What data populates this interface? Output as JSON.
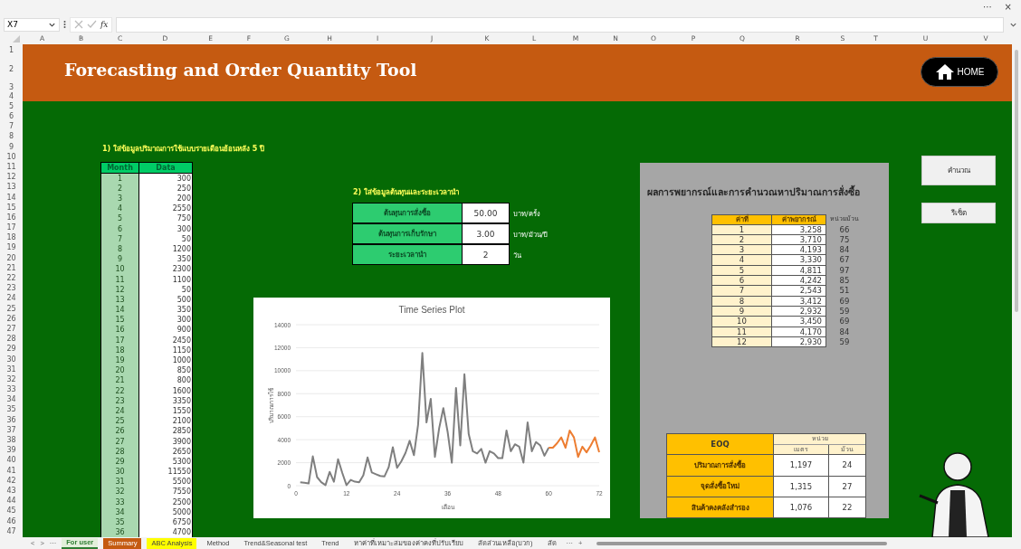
{
  "window": {
    "more": "···",
    "close": "×"
  },
  "formula_bar": {
    "name_box": "X7",
    "function_label": "fx"
  },
  "columns": [
    "A",
    "B",
    "C",
    "D",
    "E",
    "F",
    "G",
    "H",
    "I",
    "J",
    "K",
    "L",
    "M",
    "N",
    "O",
    "P",
    "Q",
    "R",
    "S",
    "T",
    "U",
    "V"
  ],
  "rows": [
    "1",
    "2",
    "3",
    "4",
    "5",
    "6",
    "7",
    "8",
    "9",
    "10",
    "11",
    "12",
    "13",
    "14",
    "15",
    "16",
    "17",
    "18",
    "19",
    "20",
    "21",
    "22",
    "23",
    "24",
    "25",
    "26",
    "27",
    "28",
    "29",
    "30",
    "31",
    "32",
    "33",
    "34",
    "35",
    "36",
    "37",
    "38",
    "39",
    "40",
    "41",
    "42",
    "43",
    "44",
    "45",
    "46",
    "47"
  ],
  "banner": {
    "title": "Forecasting and Order Quantity Tool",
    "home_button": "HOME"
  },
  "usage": {
    "heading": "1) ใส่ข้อมูลปริมาณการใช้แบบรายเดือนย้อนหลัง 5 ปี",
    "columns": [
      "Month",
      "Data"
    ],
    "rows": [
      [
        "1",
        "300"
      ],
      [
        "2",
        "250"
      ],
      [
        "3",
        "200"
      ],
      [
        "4",
        "2550"
      ],
      [
        "5",
        "750"
      ],
      [
        "6",
        "300"
      ],
      [
        "7",
        "50"
      ],
      [
        "8",
        "1200"
      ],
      [
        "9",
        "350"
      ],
      [
        "10",
        "2300"
      ],
      [
        "11",
        "1100"
      ],
      [
        "12",
        "50"
      ],
      [
        "13",
        "500"
      ],
      [
        "14",
        "350"
      ],
      [
        "15",
        "300"
      ],
      [
        "16",
        "900"
      ],
      [
        "17",
        "2450"
      ],
      [
        "18",
        "1150"
      ],
      [
        "19",
        "1000"
      ],
      [
        "20",
        "850"
      ],
      [
        "21",
        "800"
      ],
      [
        "22",
        "1600"
      ],
      [
        "23",
        "3350"
      ],
      [
        "24",
        "1550"
      ],
      [
        "25",
        "2100"
      ],
      [
        "26",
        "2850"
      ],
      [
        "27",
        "3900"
      ],
      [
        "28",
        "2650"
      ],
      [
        "29",
        "5300"
      ],
      [
        "30",
        "11550"
      ],
      [
        "31",
        "5500"
      ],
      [
        "32",
        "7550"
      ],
      [
        "33",
        "2500"
      ],
      [
        "34",
        "5000"
      ],
      [
        "35",
        "6750"
      ],
      [
        "36",
        "4700"
      ]
    ]
  },
  "costs": {
    "heading": "2) ใส่ข้อมูลต้นทุนและระยะเวลานำ",
    "rows": [
      {
        "label": "ต้นทุนการสั่งซื้อ",
        "value": "50.00",
        "unit": "บาท/ครั้ง"
      },
      {
        "label": "ต้นทุนการเก็บรักษา",
        "value": "3.00",
        "unit": "บาท/ม้วน/ปี"
      },
      {
        "label": "ระยะเวลานำ",
        "value": "2",
        "unit": "วัน"
      }
    ]
  },
  "chart": {
    "chart_data": {
      "type": "line",
      "grid": true,
      "title": "Time Series Plot",
      "xlabel": "เดือน",
      "ylabel": "ปริมาณการใช้",
      "xlim": [
        0,
        72
      ],
      "ylim": [
        0,
        14000
      ],
      "xticks": [
        0,
        12,
        24,
        36,
        48,
        60,
        72
      ],
      "yticks": [
        0,
        2000,
        4000,
        6000,
        8000,
        10000,
        12000,
        14000
      ],
      "x": [
        1,
        2,
        3,
        4,
        5,
        6,
        7,
        8,
        9,
        10,
        11,
        12,
        13,
        14,
        15,
        16,
        17,
        18,
        19,
        20,
        21,
        22,
        23,
        24,
        25,
        26,
        27,
        28,
        29,
        30,
        31,
        32,
        33,
        34,
        35,
        36,
        37,
        38,
        39,
        40,
        41,
        42,
        43,
        44,
        45,
        46,
        47,
        48,
        49,
        50,
        51,
        52,
        53,
        54,
        55,
        56,
        57,
        58,
        59,
        60,
        61,
        62,
        63,
        64,
        65,
        66,
        67,
        68,
        69,
        70,
        71,
        72
      ],
      "series": [
        {
          "color": "#7f7f7f",
          "values": [
            300,
            250,
            200,
            2550,
            750,
            300,
            50,
            1200,
            350,
            2300,
            1100,
            50,
            500,
            350,
            300,
            900,
            2450,
            1150,
            1000,
            850,
            800,
            1600,
            3350,
            1550,
            2100,
            2850,
            3900,
            2650,
            5300,
            11550,
            5500,
            7550,
            2500,
            5000,
            6750,
            4700,
            2000,
            8500,
            3500,
            9700,
            4500,
            3000,
            2800,
            3200,
            2000,
            3000,
            2800,
            2400,
            2400,
            4800,
            3000,
            3600,
            3400,
            2000,
            5500,
            3000,
            3800,
            3500,
            2600,
            3300,
            null,
            null,
            null,
            null,
            null,
            null,
            null,
            null,
            null,
            null,
            null,
            null
          ]
        },
        {
          "color": "#ed7d31",
          "values": [
            null,
            null,
            null,
            null,
            null,
            null,
            null,
            null,
            null,
            null,
            null,
            null,
            null,
            null,
            null,
            null,
            null,
            null,
            null,
            null,
            null,
            null,
            null,
            null,
            null,
            null,
            null,
            null,
            null,
            null,
            null,
            null,
            null,
            null,
            null,
            null,
            null,
            null,
            null,
            null,
            null,
            null,
            null,
            null,
            null,
            null,
            null,
            null,
            null,
            null,
            null,
            null,
            null,
            null,
            null,
            null,
            null,
            null,
            null,
            3300,
            3300,
            3700,
            4200,
            3300,
            4800,
            4200,
            2500,
            3400,
            2900,
            3500,
            4200,
            2900
          ]
        }
      ]
    }
  },
  "results": {
    "heading": "ผลการพยากรณ์และการคำนวณหาปริมาณการสั่งซื้อ",
    "columns": [
      "ค่าที่",
      "ค่าพยากรณ์",
      "หน่วยม้วน"
    ],
    "rows": [
      [
        "1",
        "3,258",
        "66"
      ],
      [
        "2",
        "3,710",
        "75"
      ],
      [
        "3",
        "4,193",
        "84"
      ],
      [
        "4",
        "3,330",
        "67"
      ],
      [
        "5",
        "4,811",
        "97"
      ],
      [
        "6",
        "4,242",
        "85"
      ],
      [
        "7",
        "2,543",
        "51"
      ],
      [
        "8",
        "3,412",
        "69"
      ],
      [
        "9",
        "2,932",
        "59"
      ],
      [
        "10",
        "3,450",
        "69"
      ],
      [
        "11",
        "4,170",
        "84"
      ],
      [
        "12",
        "2,930",
        "59"
      ]
    ]
  },
  "eoq": {
    "title": "EOQ",
    "unit_heading": "หน่วย",
    "unit_columns": [
      "เมตร",
      "ม้วน"
    ],
    "rows": [
      {
        "label": "ปริมาณการสั่งซื้อ",
        "meter": "1,197",
        "roll": "24"
      },
      {
        "label": "จุดสั่งซื้อใหม่",
        "meter": "1,315",
        "roll": "27"
      },
      {
        "label": "สินค้าคงคลังสำรอง",
        "meter": "1,076",
        "roll": "22"
      }
    ]
  },
  "buttons": [
    "คำนวณ",
    "รีเซ็ต"
  ],
  "sheet_tabs": {
    "nav": [
      "<",
      ">",
      "···"
    ],
    "tabs": [
      {
        "label": "For user",
        "selected": true,
        "color": "#e2efda"
      },
      {
        "label": "Summary",
        "selected": false,
        "color": "#c55a11"
      },
      {
        "label": "ABC Analysis",
        "selected": false,
        "color": "#ffff00"
      },
      {
        "label": "Method",
        "selected": false
      },
      {
        "label": "Trend&Seasonal test",
        "selected": false
      },
      {
        "label": "Trend",
        "selected": false
      },
      {
        "label": "หาค่าที่เหมาะสมของค่าคงที่ปรับเรียบ",
        "selected": false
      },
      {
        "label": "สัดส่วนเหลือ(บวก)",
        "selected": false
      },
      {
        "label": "สัด",
        "selected": false
      }
    ],
    "more": "···",
    "add": "+"
  }
}
